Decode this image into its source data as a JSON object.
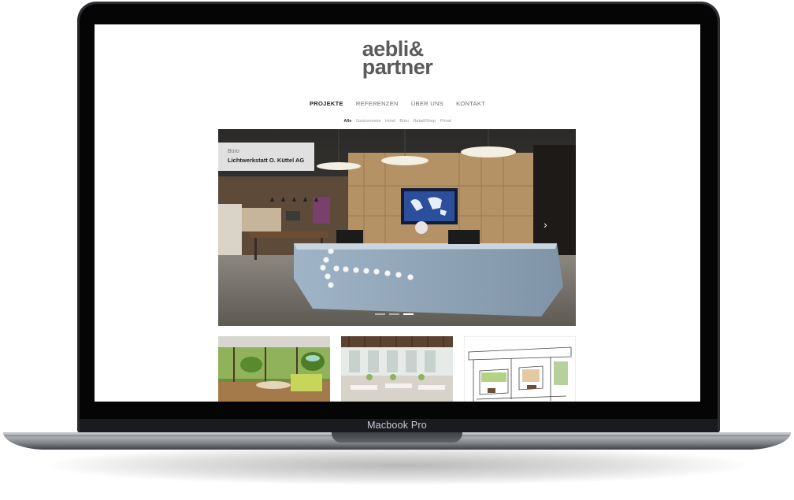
{
  "device": {
    "label": "Macbook Pro"
  },
  "site": {
    "logo_line1": "aebli&",
    "logo_line2": "partner",
    "nav": [
      {
        "label": "PROJEKTE",
        "active": true
      },
      {
        "label": "REFERENZEN"
      },
      {
        "label": "ÜBER UNS"
      },
      {
        "label": "KONTAKT"
      }
    ],
    "filters": [
      {
        "label": "Alle",
        "active": true
      },
      {
        "label": "Gastronomie"
      },
      {
        "label": "Hotel"
      },
      {
        "label": "Büro"
      },
      {
        "label": "Retail/Shop"
      },
      {
        "label": "Privat"
      }
    ],
    "hero": {
      "category": "Büro",
      "title": "Lichtwerkstatt O. Küttel AG",
      "next_icon": "chevron-right-icon",
      "slides": 3,
      "active_slide": 3
    }
  },
  "colors": {
    "logo": "#5a5a5a",
    "nav_active": "#222222",
    "bezel": "#050505"
  }
}
